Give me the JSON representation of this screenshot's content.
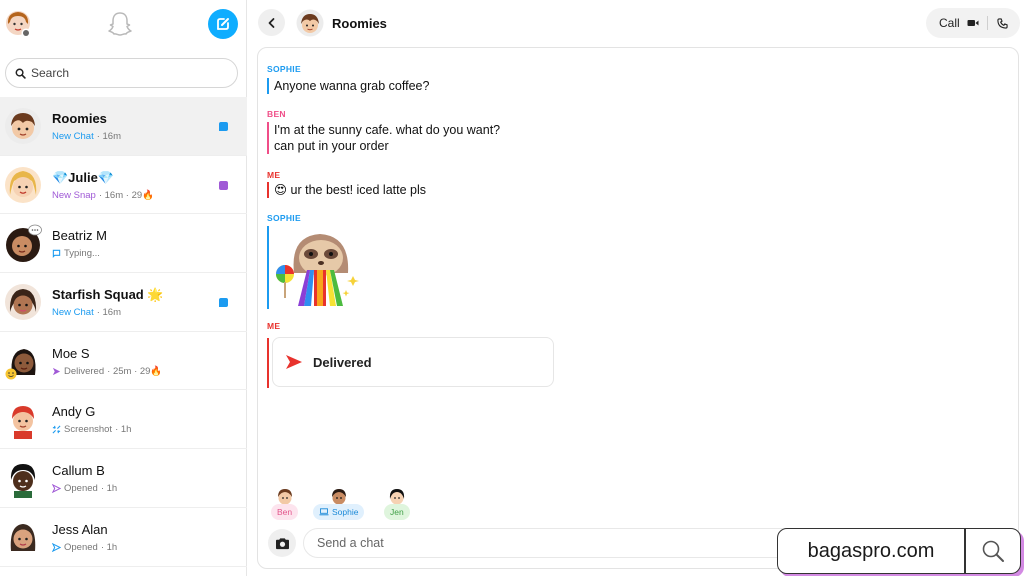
{
  "sidebar": {
    "search": {
      "placeholder": "Search"
    },
    "chats": [
      {
        "name": "Roomies",
        "status": "New Chat",
        "meta": "· 16m",
        "status_color": "#1c9bf0",
        "badge": "#1c9bf0",
        "active": true
      },
      {
        "name": "💎Julie💎",
        "status": "New Snap",
        "meta": "· 16m · 29🔥",
        "status_color": "#a05ad6",
        "badge": "#a05ad6"
      },
      {
        "name": "Beatriz M",
        "status": "Typing...",
        "meta": "",
        "status_color": "#777777"
      },
      {
        "name": "Starfish Squad 🌟",
        "status": "New Chat",
        "meta": "· 16m",
        "status_color": "#1c9bf0",
        "badge": "#1c9bf0"
      },
      {
        "name": "Moe S",
        "status": "Delivered",
        "meta": "· 25m · 29🔥",
        "status_color": "#777777"
      },
      {
        "name": "Andy G",
        "status": "Screenshot",
        "meta": "· 1h",
        "status_color": "#777777"
      },
      {
        "name": "Callum B",
        "status": "Opened",
        "meta": "· 1h",
        "status_color": "#777777"
      },
      {
        "name": "Jess Alan",
        "status": "Opened",
        "meta": "· 1h",
        "status_color": "#777777"
      }
    ]
  },
  "header": {
    "title": "Roomies",
    "call_label": "Call"
  },
  "messages": {
    "m1_sender": "SOPHIE",
    "m1_text": "Anyone wanna grab coffee?",
    "m2_sender": "BEN",
    "m2_line1": "I'm at the sunny cafe. what do you want?",
    "m2_line2": "can put in your order",
    "m3_sender": "ME",
    "m3_emoji": "😍",
    "m3_text": "ur the best! iced latte pls",
    "m4_sender": "SOPHIE",
    "m5_sender": "ME",
    "m5_status": "Delivered"
  },
  "presence": {
    "ben": "Ben",
    "sophie": "Sophie",
    "jen": "Jen"
  },
  "composer": {
    "placeholder": "Send a chat"
  },
  "watermark": {
    "text": "bagaspro.com"
  },
  "colors": {
    "accent": "#0fadff",
    "sophie": "#1c9bf0",
    "ben": "#f04e88",
    "me": "#e8322d"
  }
}
